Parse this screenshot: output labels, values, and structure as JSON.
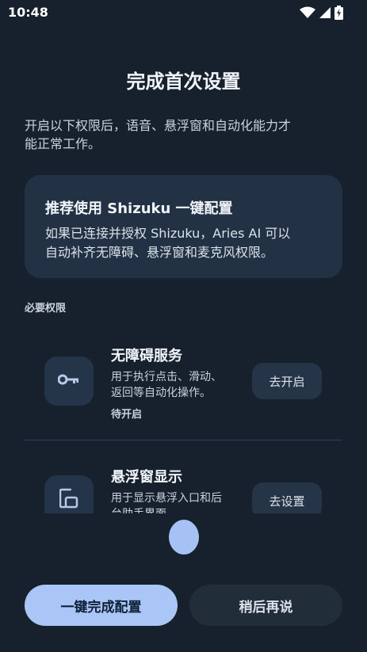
{
  "status_bar": {
    "time": "10:48",
    "icons": [
      "wifi-icon",
      "signal-icon",
      "battery-charging-icon"
    ]
  },
  "page": {
    "title": "完成首次设置",
    "intro_line1": "开启以下权限后，语音、悬浮窗和自动化能力才",
    "intro_line2": "能正常工作。"
  },
  "shizuku_card": {
    "title": "推荐使用 Shizuku 一键配置",
    "desc_line1": "如果已连接并授权 Shizuku，Aries AI 可以",
    "desc_line2": "自动补齐无障碍、悬浮窗和麦克风权限。"
  },
  "section": {
    "label": "必要权限"
  },
  "permissions": [
    {
      "icon": "key-icon",
      "title": "无障碍服务",
      "desc_line1": "用于执行点击、滑动、",
      "desc_line2": "返回等自动化操作。",
      "status": "待开启",
      "button_label": "去开启"
    },
    {
      "icon": "overlay-window-icon",
      "title": "悬浮窗显示",
      "desc_line1": "用于显示悬浮入口和后",
      "desc_line2": "台助手界面",
      "button_label": "去设置"
    }
  ],
  "actions": {
    "primary_label": "一键完成配置",
    "secondary_label": "稍后再说"
  },
  "colors": {
    "background": "#17212e",
    "card": "#223144",
    "accent": "#a9c6f7"
  }
}
